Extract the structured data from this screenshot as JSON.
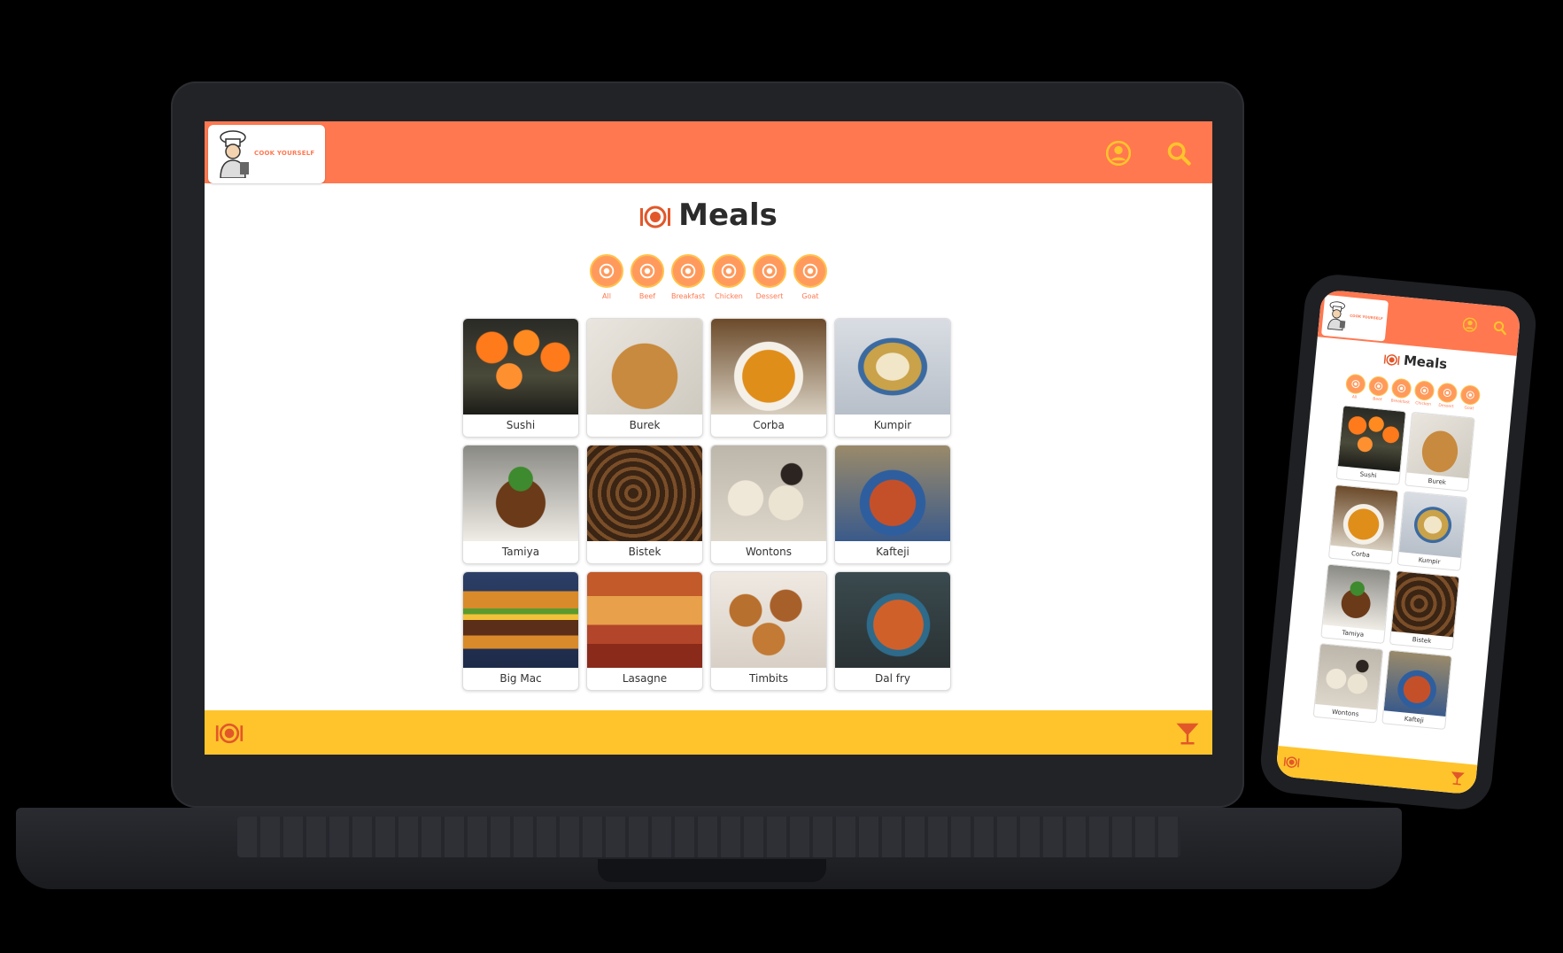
{
  "app": {
    "logo_text": "COOK YOURSELF"
  },
  "page": {
    "title": "Meals"
  },
  "categories": [
    {
      "label": "All",
      "icon": "plate-icon"
    },
    {
      "label": "Beef",
      "icon": "cow-icon"
    },
    {
      "label": "Breakfast",
      "icon": "breakfast-icon"
    },
    {
      "label": "Chicken",
      "icon": "chicken-icon"
    },
    {
      "label": "Dessert",
      "icon": "cake-icon"
    },
    {
      "label": "Goat",
      "icon": "goat-icon"
    }
  ],
  "meals": [
    {
      "name": "Sushi",
      "img": "f-sushi"
    },
    {
      "name": "Burek",
      "img": "f-burek"
    },
    {
      "name": "Corba",
      "img": "f-corba"
    },
    {
      "name": "Kumpir",
      "img": "f-kumpir"
    },
    {
      "name": "Tamiya",
      "img": "f-tamiya"
    },
    {
      "name": "Bistek",
      "img": "f-bistek"
    },
    {
      "name": "Wontons",
      "img": "f-wontons"
    },
    {
      "name": "Kafteji",
      "img": "f-kafteji"
    },
    {
      "name": "Big Mac",
      "img": "f-bigmac"
    },
    {
      "name": "Lasagne",
      "img": "f-lasagne"
    },
    {
      "name": "Timbits",
      "img": "f-timbits"
    },
    {
      "name": "Dal fry",
      "img": "f-dalfry"
    }
  ],
  "phone_meals": [
    {
      "name": "Sushi",
      "img": "f-sushi"
    },
    {
      "name": "Burek",
      "img": "f-burek"
    },
    {
      "name": "Corba",
      "img": "f-corba"
    },
    {
      "name": "Kumpir",
      "img": "f-kumpir"
    },
    {
      "name": "Tamiya",
      "img": "f-tamiya"
    },
    {
      "name": "Bistek",
      "img": "f-bistek"
    },
    {
      "name": "Wontons",
      "img": "f-wontons"
    },
    {
      "name": "Kafteji",
      "img": "f-kafteji"
    }
  ],
  "icons": {
    "header": [
      "user-icon",
      "search-icon"
    ],
    "footer": [
      "meals-icon",
      "cocktail-icon"
    ]
  },
  "colors": {
    "header": "#ff7850",
    "footer": "#ffc42c",
    "accent": "#ff7850"
  }
}
